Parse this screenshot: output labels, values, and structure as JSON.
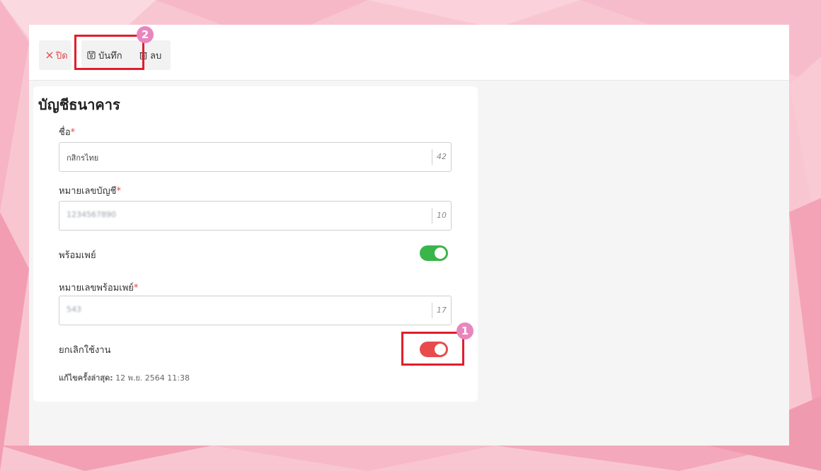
{
  "toolbar": {
    "close_label": "ปิด",
    "save_label": "บันทึก",
    "delete_label": "ลบ",
    "close_color": "#e24848"
  },
  "form": {
    "title": "บัญชีธนาคาร",
    "name": {
      "label": "ชื่อ",
      "required": "*",
      "value": "กสิกรไทย",
      "counter": "42"
    },
    "account_number": {
      "label": "หมายเลขบัญชี",
      "required": "*",
      "value": "1234567890",
      "counter": "10"
    },
    "promptpay": {
      "label": "พร้อมเพย์",
      "enabled": true,
      "color": "#3ab54a"
    },
    "promptpay_number": {
      "label": "หมายเลขพร้อมเพย์",
      "required": "*",
      "value": "543",
      "counter": "17"
    },
    "deactivate": {
      "label": "ยกเลิกใช้งาน",
      "enabled": true,
      "color": "#e84b4b"
    },
    "last_edited": {
      "label": "แก้ไขครั้งล่าสุด:",
      "value": "12 พ.ย. 2564 11:38"
    }
  },
  "annotations": {
    "badge_1": "1",
    "badge_2": "2",
    "box_color": "#e01e2c",
    "badge_color": "#e986be"
  }
}
